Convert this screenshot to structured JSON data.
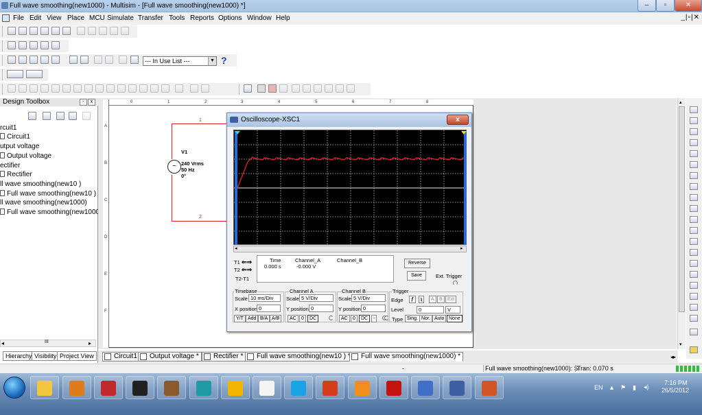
{
  "window": {
    "title": "Full wave smoothing(new1000) - Multisim - [Full wave smoothing(new1000) *]",
    "min": "–",
    "max": "▫",
    "close": "✕"
  },
  "menu": {
    "items": [
      "File",
      "Edit",
      "View",
      "Place",
      "MCU",
      "Simulate",
      "Transfer",
      "Tools",
      "Reports",
      "Options",
      "Window",
      "Help"
    ],
    "mdi_controls": "_|▫|✕"
  },
  "toolbar": {
    "in_use_list": "--- In Use List ---",
    "help": "?"
  },
  "toolbox": {
    "title": "Design Toolbox",
    "pin": "-",
    "close": "x",
    "tree": [
      {
        "label": "rcuit1",
        "folder": false
      },
      {
        "label": "Circuit1",
        "folder": true
      },
      {
        "label": "utput voltage",
        "folder": false
      },
      {
        "label": "Output voltage",
        "folder": true
      },
      {
        "label": "ectifier",
        "folder": false
      },
      {
        "label": "Rectifier",
        "folder": true
      },
      {
        "label": "ll wave smoothing(new10 )",
        "folder": false
      },
      {
        "label": "Full wave smoothing(new10 )",
        "folder": true
      },
      {
        "label": "ll wave smoothing(new1000)",
        "folder": false
      },
      {
        "label": "Full wave smoothing(new1000)",
        "folder": true
      }
    ],
    "tabs": [
      "Hierarchy",
      "Visibility",
      "Project View"
    ],
    "hscroll_mid": "III"
  },
  "ruler": {
    "top": [
      "0",
      "1",
      "2",
      "3",
      "4",
      "5",
      "6",
      "7",
      "8"
    ],
    "left": [
      "A",
      "B",
      "C",
      "D",
      "E",
      "F"
    ]
  },
  "circuit": {
    "source_name": "V1",
    "source_voltage": "240 Vrms",
    "source_freq": "50 Hz",
    "source_phase": "0°",
    "node1": "1",
    "node2": "2"
  },
  "scope": {
    "title": "Oscilloscope-XSC1",
    "close": "x",
    "t1": "T1",
    "t2": "T2",
    "t2t1": "T2-T1",
    "hdr_time": "Time",
    "hdr_cha": "Channel_A",
    "hdr_chb": "Channel_B",
    "time_val": "0.000 s",
    "cha_val": "-0.000 V",
    "reverse": "Reverse",
    "save": "Save",
    "ext_trigger": "Ext. Trigger",
    "timebase": {
      "label": "Timebase",
      "scale_label": "Scale",
      "scale": "10 ms/Div",
      "xpos_label": "X position",
      "xpos": "0",
      "buttons": [
        "Y/T",
        "Add",
        "B/A",
        "A/B"
      ]
    },
    "channel_a": {
      "label": "Channel A",
      "scale_label": "Scale",
      "scale": "5 V/Div",
      "ypos_label": "Y position",
      "ypos": "0",
      "buttons": [
        "AC",
        "0",
        "DC"
      ]
    },
    "channel_b": {
      "label": "Channel B",
      "scale_label": "Scale",
      "scale": "5 V/Div",
      "ypos_label": "Y position",
      "ypos": "0",
      "buttons": [
        "AC",
        "0",
        "DC",
        "-"
      ]
    },
    "trigger": {
      "label": "Trigger",
      "edge_label": "Edge",
      "edge_buttons": [
        "A",
        "B",
        "Ext"
      ],
      "level_label": "Level",
      "level": "0",
      "unit": "V",
      "type_label": "Type",
      "type_buttons": [
        "Sing.",
        "Nor.",
        "Auto",
        "None"
      ]
    },
    "trace_color": "#e02020"
  },
  "sheet_tabs": [
    "Circuit1",
    "Output voltage *",
    "Rectifier *",
    "Full wave smoothing(new10 ) *",
    "Full wave smoothing(new1000) *"
  ],
  "status": {
    "dash": "-",
    "sim_info": "Full wave smoothing(new1000): Si",
    "tran": "Tran: 0.070 s"
  },
  "tray": {
    "lang": "EN",
    "time": "7:16 PM",
    "date": "26/5/2012"
  },
  "taskbar_apps": [
    {
      "name": "file-explorer-icon",
      "color": "#f3c640"
    },
    {
      "name": "media-player-icon",
      "color": "#e07a1f"
    },
    {
      "name": "microchip-icon",
      "color": "#c02a2a"
    },
    {
      "name": "pickit2-icon",
      "color": "#202020"
    },
    {
      "name": "bug-app-icon",
      "color": "#8b5a2b"
    },
    {
      "name": "arduino-icon",
      "color": "#1e9aa5"
    },
    {
      "name": "chrome-icon",
      "color": "#f2b400"
    },
    {
      "name": "wireless-icon",
      "color": "#f4f4f4"
    },
    {
      "name": "skype-icon",
      "color": "#1aa3e6"
    },
    {
      "name": "app-red-icon",
      "color": "#d43d1a"
    },
    {
      "name": "virtualbox-icon",
      "color": "#f28f1c"
    },
    {
      "name": "acrobat-icon",
      "color": "#c4140f"
    },
    {
      "name": "graph-app-icon",
      "color": "#3f6fc6"
    },
    {
      "name": "multisim-icon",
      "color": "#3e5fa3"
    },
    {
      "name": "powerpoint-icon",
      "color": "#d2552a"
    }
  ]
}
